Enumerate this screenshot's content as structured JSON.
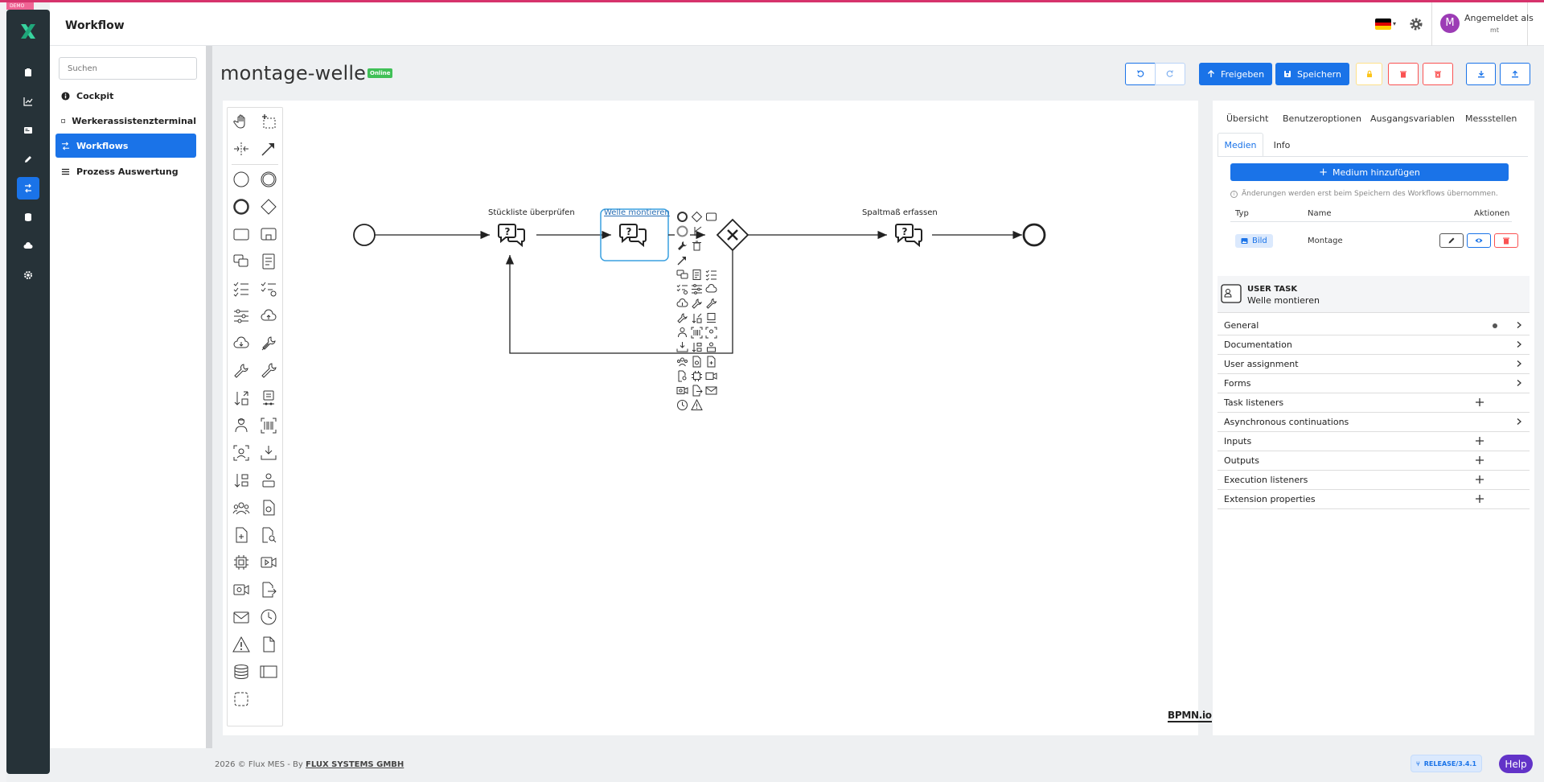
{
  "env_badge": "DEMO",
  "app": {
    "title": "Workflow"
  },
  "user": {
    "avatar_letter": "M",
    "line1": "Angemeldet als",
    "line2": "mt"
  },
  "sidebar": {
    "search_placeholder": "Suchen",
    "items": [
      {
        "label": "Cockpit",
        "icon": "info-icon"
      },
      {
        "label": "Werkerassistenzterminal",
        "icon": "tablet-icon"
      },
      {
        "label": "Workflows",
        "icon": "workflow-icon",
        "active": true
      },
      {
        "label": "Prozess Auswertung",
        "icon": "list-icon"
      }
    ]
  },
  "page": {
    "title": "montage-welle",
    "status_badge": "Online"
  },
  "toolbar": {
    "release_label": "Freigeben",
    "save_label": "Speichern"
  },
  "diagram": {
    "tasks": [
      {
        "label": "Stückliste überprüfen"
      },
      {
        "label": "Welle montieren",
        "selected": true
      },
      {
        "label": "Spaltmaß erfassen"
      }
    ],
    "watermark": "BPMN.io"
  },
  "panel": {
    "tabs": [
      "Übersicht",
      "Benutzeroptionen",
      "Ausgangsvariablen",
      "Messstellen"
    ],
    "subtabs": [
      "Medien",
      "Info"
    ],
    "active_subtab": "Medien",
    "add_media_label": "Medium hinzufügen",
    "note": "Änderungen werden erst beim Speichern des Workflows übernommen.",
    "table": {
      "headers": [
        "Typ",
        "Name",
        "Aktionen"
      ],
      "rows": [
        {
          "type": "Bild",
          "name": "Montage"
        }
      ]
    },
    "task_type": "USER TASK",
    "task_name": "Welle montieren",
    "groups": [
      {
        "label": "General",
        "kind": "chevron",
        "dot": true
      },
      {
        "label": "Documentation",
        "kind": "chevron"
      },
      {
        "label": "User assignment",
        "kind": "chevron"
      },
      {
        "label": "Forms",
        "kind": "chevron"
      },
      {
        "label": "Task listeners",
        "kind": "plus"
      },
      {
        "label": "Asynchronous continuations",
        "kind": "chevron"
      },
      {
        "label": "Inputs",
        "kind": "plus"
      },
      {
        "label": "Outputs",
        "kind": "plus"
      },
      {
        "label": "Execution listeners",
        "kind": "plus"
      },
      {
        "label": "Extension properties",
        "kind": "plus"
      }
    ]
  },
  "footer": {
    "year": "2026",
    "copyright_text": "© Flux MES - By",
    "company": "FLUX SYSTEMS GMBH",
    "release": "RELEASE/3.4.1",
    "help": "Help"
  },
  "colors": {
    "primary": "#1a73e8",
    "sidebar_dark": "#263238",
    "success": "#40c057",
    "danger": "#fa5252",
    "warning": "#fab005",
    "help": "#6233c8",
    "avatar": "#9c3cb5"
  }
}
